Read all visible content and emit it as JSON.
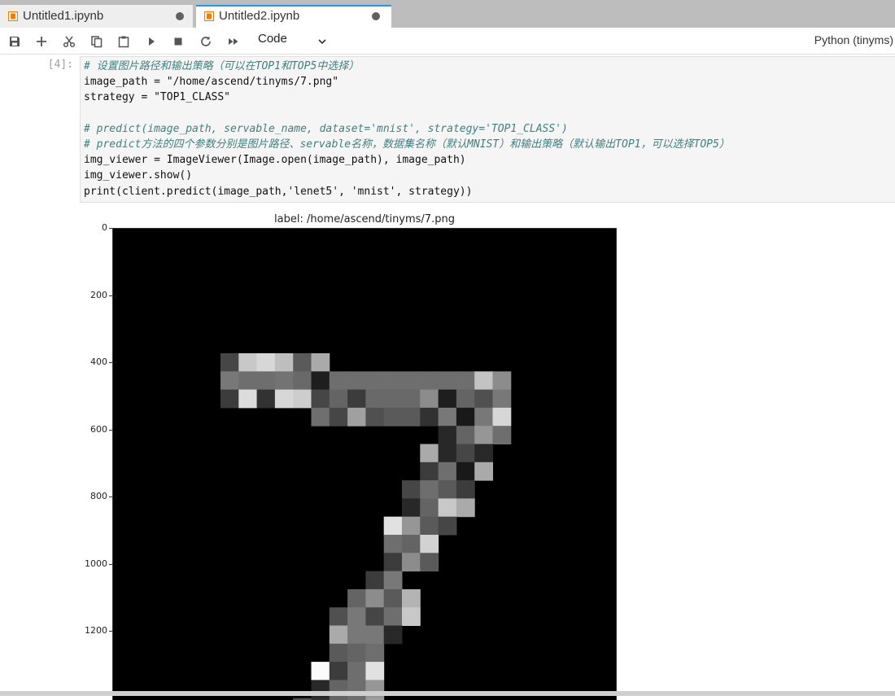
{
  "tabs": [
    {
      "label": "Untitled1.ipynb",
      "active": false,
      "unsaved": true
    },
    {
      "label": "Untitled2.ipynb",
      "active": true,
      "unsaved": true
    }
  ],
  "toolbar": {
    "icons": [
      "save-icon",
      "add-icon",
      "cut-icon",
      "copy-icon",
      "paste-icon",
      "run-icon",
      "stop-icon",
      "restart-icon",
      "fast-forward-icon"
    ],
    "cell_type": "Code",
    "kernel": "Python (tinyms)"
  },
  "cell": {
    "prompt": "[4]:",
    "lines": [
      "# 设置图片路径和输出策略（可以在TOP1和TOP5中选择）",
      "image_path = \"/home/ascend/tinyms/7.png\"",
      "strategy = \"TOP1_CLASS\"",
      "",
      "# predict(image_path, servable_name, dataset='mnist', strategy='TOP1_CLASS')",
      "# predict方法的四个参数分别是图片路径、servable名称，数据集名称（默认MNIST）和输出策略（默认输出TOP1，可以选择TOP5）",
      "img_viewer = ImageViewer(Image.open(image_path), image_path)",
      "img_viewer.show()",
      "print(client.predict(image_path,'lenet5', 'mnist', strategy))"
    ]
  },
  "figure": {
    "title": "label: /home/ascend/tinyms/7.png",
    "yticks": [
      "0",
      "200",
      "400",
      "600",
      "800",
      "1000",
      "1200"
    ],
    "ytick_values": [
      0,
      200,
      400,
      600,
      800,
      1000,
      1200
    ],
    "y_range_visible": [
      0,
      1370
    ],
    "image_background": "#000000"
  },
  "colors": {
    "tabbar": "#bdbdbd",
    "active_tab_accent": "#2196f3",
    "notebook_icon": "#f57c00",
    "editor_bg": "#f5f5f5"
  }
}
